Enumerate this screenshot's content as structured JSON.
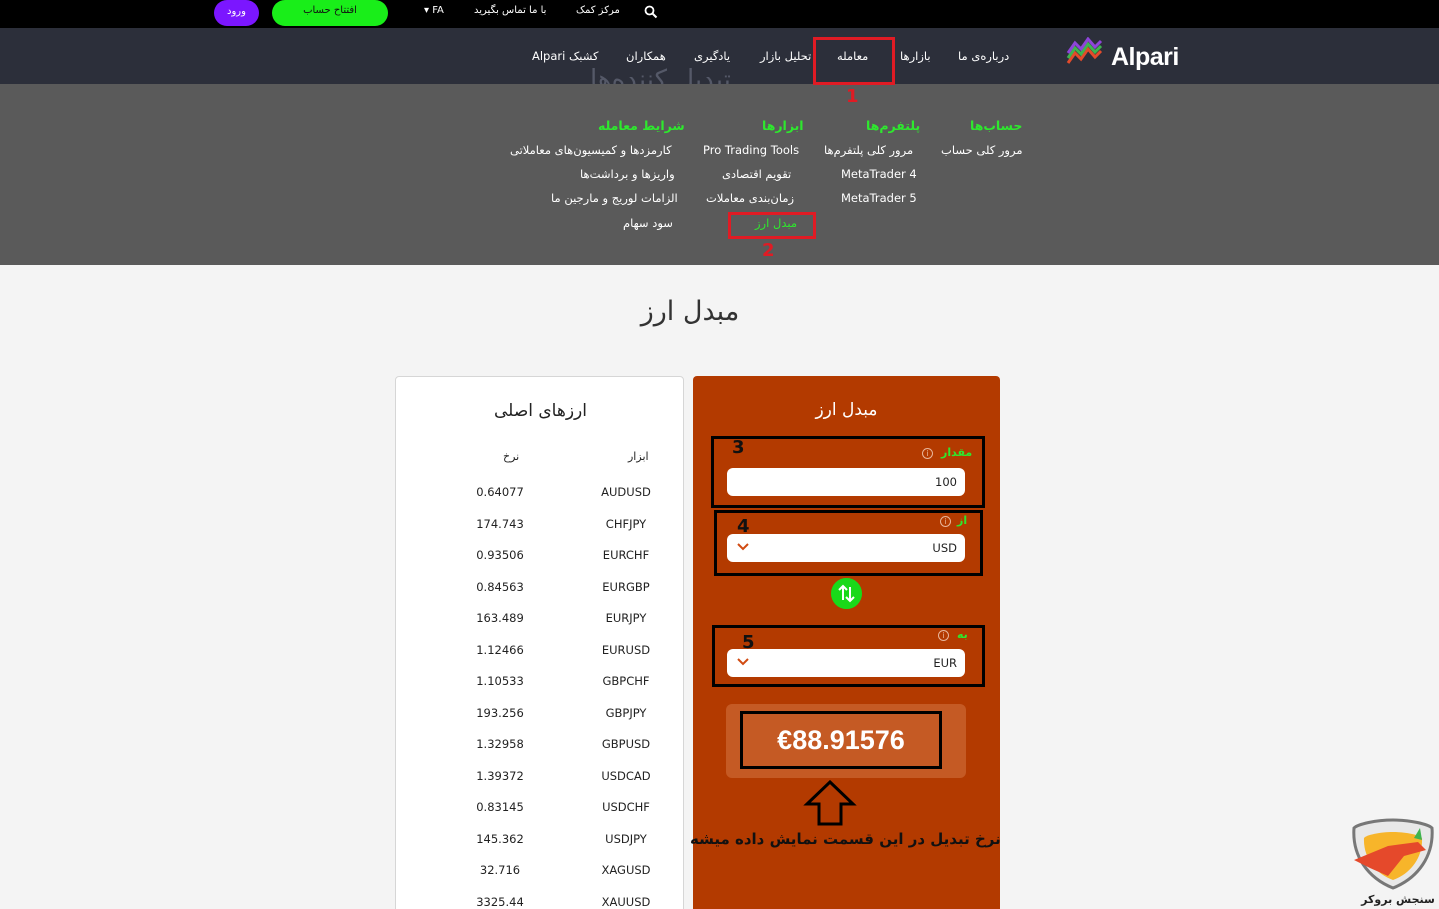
{
  "topbar": {
    "login": "ورود",
    "open_account": "افتتاح حساب",
    "language": "FA",
    "contact": "با ما تماس بگیرید",
    "help": "مرکز کمک"
  },
  "nav": {
    "brand": "Alpari",
    "items": [
      "درباره‌ی ما",
      "بازارها",
      "معامله",
      "تحلیل بازار",
      "یادگیری",
      "همکاران",
      "Alpari کشبک"
    ],
    "watermark": "تبدیل کننده‌ها"
  },
  "mega": {
    "columns": [
      {
        "heading": "حساب‌ها",
        "items": [
          "مرور کلی حساب"
        ]
      },
      {
        "heading": "پلتفرم‌ها",
        "items": [
          "مرور کلی پلتفرم‌ها",
          "MetaTrader 4",
          "MetaTrader 5"
        ]
      },
      {
        "heading": "ابزارها",
        "items": [
          "Pro Trading Tools",
          "تقویم اقتصادی",
          "زمان‌بندی معاملات",
          "مبدل ارز"
        ]
      },
      {
        "heading": "شرایط معامله",
        "items": [
          "کارمزدها و کمیسیون‌های معاملاتی",
          "واریزها و برداشت‌ها",
          "الزامات لوریج و مارجین ما",
          "سود سهام"
        ]
      }
    ]
  },
  "annotations": {
    "n1": "1",
    "n2": "2",
    "n3": "3",
    "n4": "4",
    "n5": "5"
  },
  "page": {
    "title": "مبدل ارز"
  },
  "rates": {
    "title": "ارزهای اصلی",
    "col_symbol": "ابزار",
    "col_rate": "نرخ",
    "rows": [
      {
        "symbol": "AUDUSD",
        "rate": "0.64077"
      },
      {
        "symbol": "CHFJPY",
        "rate": "174.743"
      },
      {
        "symbol": "EURCHF",
        "rate": "0.93506"
      },
      {
        "symbol": "EURGBP",
        "rate": "0.84563"
      },
      {
        "symbol": "EURJPY",
        "rate": "163.489"
      },
      {
        "symbol": "EURUSD",
        "rate": "1.12466"
      },
      {
        "symbol": "GBPCHF",
        "rate": "1.10533"
      },
      {
        "symbol": "GBPJPY",
        "rate": "193.256"
      },
      {
        "symbol": "GBPUSD",
        "rate": "1.32958"
      },
      {
        "symbol": "USDCAD",
        "rate": "1.39372"
      },
      {
        "symbol": "USDCHF",
        "rate": "0.83145"
      },
      {
        "symbol": "USDJPY",
        "rate": "145.362"
      },
      {
        "symbol": "XAGUSD",
        "rate": "32.716"
      },
      {
        "symbol": "XAUUSD",
        "rate": "3325.44"
      }
    ]
  },
  "converter": {
    "title": "مبدل ارز",
    "amount_label": "مقدار",
    "amount_value": "100",
    "from_label": "از",
    "from_value": "USD",
    "to_label": "به",
    "to_value": "EUR",
    "result": "€88.91576",
    "caption": "نرخ تبدیل در این قسمت نمایش داده میشه"
  },
  "corner": {
    "text": "سنجش بروکر"
  },
  "colors": {
    "accent_green": "#19ee19",
    "login_purple": "#7b16ff",
    "converter_bg": "#b33a00",
    "annotation_red": "#e01b24"
  }
}
